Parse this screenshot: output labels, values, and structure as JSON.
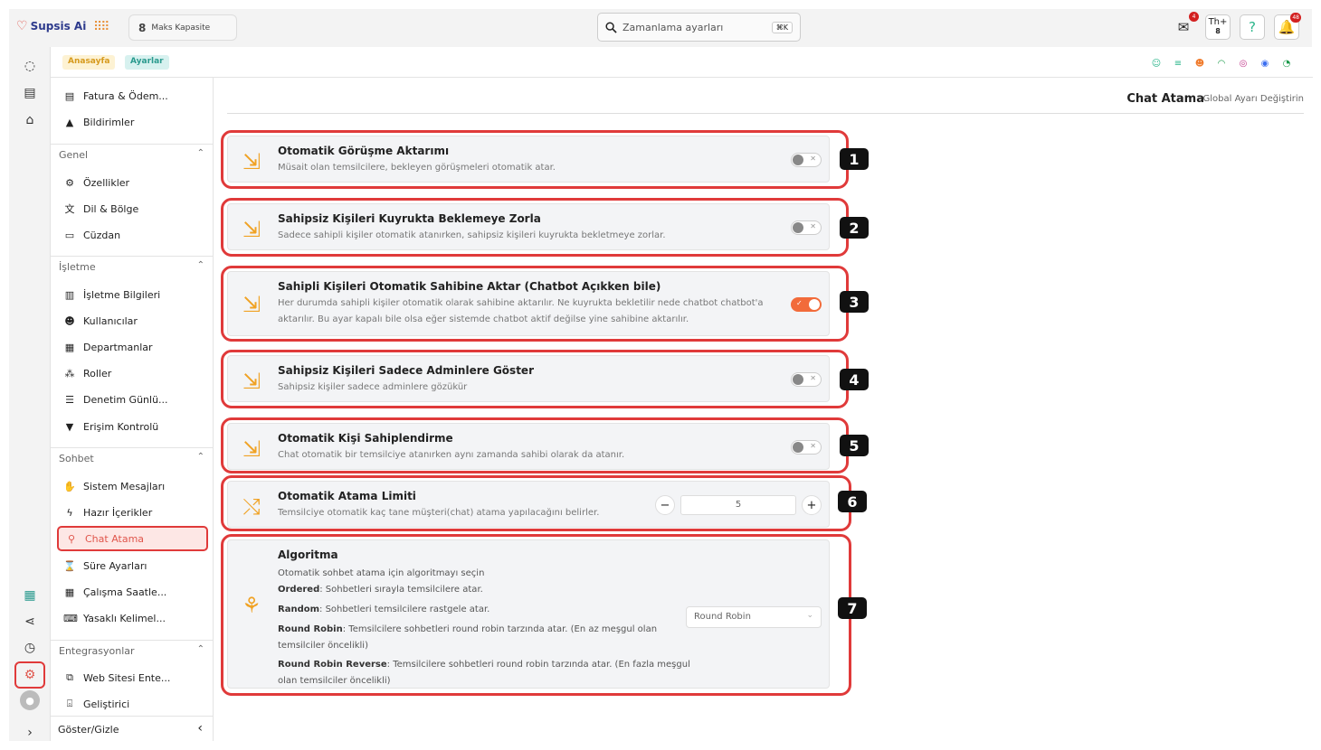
{
  "app": {
    "name": "Supsis Ai"
  },
  "capacity": {
    "value": "8",
    "label": "Maks Kapasite"
  },
  "search": {
    "placeholder": "Zamanlama ayarları",
    "shortcut": "⌘K"
  },
  "top_icons": {
    "mail_badge": "4",
    "th_label": "Th",
    "th_count": "8",
    "notif_badge": "48"
  },
  "breadcrumb": {
    "home": "Anasayfa",
    "settings": "Ayarlar"
  },
  "menu": {
    "top_items": [
      "Fatura & Ödem...",
      "Bildirimler"
    ],
    "sections": {
      "genel": {
        "label": "Genel",
        "items": [
          "Özellikler",
          "Dil & Bölge",
          "Cüzdan"
        ]
      },
      "isletme": {
        "label": "İşletme",
        "items": [
          "İşletme Bilgileri",
          "Kullanıcılar",
          "Departmanlar",
          "Roller",
          "Denetim Günlü...",
          "Erişim Kontrolü"
        ]
      },
      "sohbet": {
        "label": "Sohbet",
        "items": [
          "Sistem Mesajları",
          "Hazır İçerikler",
          "Chat Atama",
          "Süre Ayarları",
          "Çalışma Saatle...",
          "Yasaklı Kelimel..."
        ]
      },
      "entegrasyonlar": {
        "label": "Entegrasyonlar",
        "items": [
          "Web Sitesi Ente...",
          "Geliştirici"
        ]
      }
    },
    "footer": "Göster/Gizle"
  },
  "page": {
    "title": "Chat Atama",
    "subtitle": "Global Ayarı Değiştirin"
  },
  "settings": [
    {
      "num": "1",
      "title": "Otomatik Görüşme Aktarımı",
      "desc": "Müsait olan temsilcilere, bekleyen görüşmeleri otomatik atar.",
      "enabled": false
    },
    {
      "num": "2",
      "title": "Sahipsiz Kişileri Kuyrukta Beklemeye Zorla",
      "desc": "Sadece sahipli kişiler otomatik atanırken, sahipsiz kişileri kuyrukta bekletmeye zorlar.",
      "enabled": false
    },
    {
      "num": "3",
      "title": "Sahipli Kişileri Otomatik Sahibine Aktar (Chatbot Açıkken bile)",
      "desc1": "Her durumda sahipli kişiler otomatik olarak sahibine aktarılır. Ne kuyrukta bekletilir nede chatbot chatbot'a",
      "desc2": "aktarılır. Bu ayar kapalı bile olsa eğer sistemde chatbot aktif değilse yine sahibine aktarılır.",
      "enabled": true
    },
    {
      "num": "4",
      "title": "Sahipsiz Kişileri Sadece Adminlere Göster",
      "desc": "Sahipsiz kişiler sadece adminlere gözükür",
      "enabled": false
    },
    {
      "num": "5",
      "title": "Otomatik Kişi Sahiplendirme",
      "desc": "Chat otomatik bir temsilciye atanırken aynı zamanda sahibi olarak da atanır.",
      "enabled": false
    },
    {
      "num": "6",
      "title": "Otomatik Atama Limiti",
      "desc": "Temsilciye otomatik kaç tane müşteri(chat) atama yapılacağını belirler.",
      "value": "5"
    },
    {
      "num": "7",
      "title": "Algoritma",
      "desc": "Otomatik sohbet atama için algoritmayı seçin",
      "ordered_k": "Ordered",
      "ordered_v": ": Sohbetleri sırayla temsilcilere atar.",
      "random_k": "Random",
      "random_v": ": Sohbetleri temsilcilere rastgele atar.",
      "rr_k": "Round Robin",
      "rr_v1": ": Temsilcilere sohbetleri round robin tarzında atar. (En az meşgul olan",
      "rr_v2": "temsilciler öncelikli)",
      "rrr_k": "Round Robin Reverse",
      "rrr_v1": ": Temsilcilere sohbetleri round robin tarzında atar. (En fazla meşgul",
      "rrr_v2": "olan temsilciler öncelikli)",
      "selected": "Round Robin"
    }
  ]
}
